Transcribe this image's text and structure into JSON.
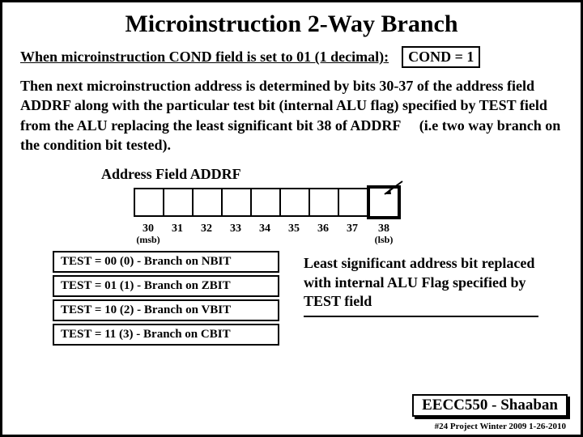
{
  "title": "Microinstruction 2-Way Branch",
  "when": "When microinstruction COND field is set to 01 (1 decimal):",
  "condbox": "COND = 1",
  "body": "Then next microinstruction address is determined by bits 30-37 of the address field ADDRF along with the particular test bit (internal ALU flag) specified by TEST field from the ALU replacing the least significant bit 38 of ADDRF  (i.e two way branch on the condition bit tested).",
  "addr_label": "Address Field ADDRF",
  "bits": [
    "30",
    "31",
    "32",
    "33",
    "34",
    "35",
    "36",
    "37",
    "38"
  ],
  "sub_msb": "(msb)",
  "sub_lsb": "(lsb)",
  "tests": [
    "TEST = 00 (0) - Branch on NBIT",
    "TEST = 01 (1) - Branch on ZBIT",
    "TEST = 10 (2) - Branch on VBIT",
    "TEST = 11 (3) - Branch on CBIT"
  ],
  "rightnote": "Least significant address bit replaced with internal ALU Flag specified by TEST field",
  "footerbox": "EECC550 - Shaaban",
  "footnote": "#24  Project  Winter 2009  1-26-2010"
}
